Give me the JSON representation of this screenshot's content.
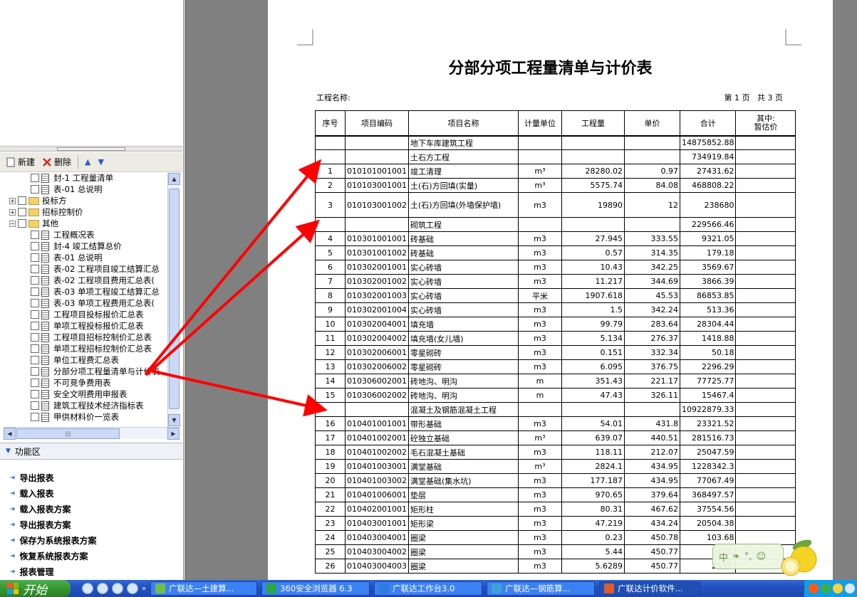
{
  "toolbar": {
    "new": "新建",
    "delete": "删除"
  },
  "tree": [
    {
      "label": "封-1 工程量清单",
      "kind": "doc",
      "lvl": 2
    },
    {
      "label": "表-01 总说明",
      "kind": "doc",
      "lvl": 2
    },
    {
      "label": "投标方",
      "kind": "folder",
      "lvl": 0
    },
    {
      "label": "招标控制价",
      "kind": "folder",
      "lvl": 0
    },
    {
      "label": "其他",
      "kind": "folder-open",
      "lvl": 0
    },
    {
      "label": "工程概况表",
      "kind": "doc",
      "lvl": 2
    },
    {
      "label": "封-4 竣工结算总价",
      "kind": "doc",
      "lvl": 2
    },
    {
      "label": "表-01 总说明",
      "kind": "doc",
      "lvl": 2
    },
    {
      "label": "表-02 工程项目竣工结算汇总",
      "kind": "doc",
      "lvl": 2
    },
    {
      "label": "表-02 工程项目费用汇总表(",
      "kind": "doc",
      "lvl": 2
    },
    {
      "label": "表-03 单项工程竣工结算汇总",
      "kind": "doc",
      "lvl": 2
    },
    {
      "label": "表-03 单项工程费用汇总表(",
      "kind": "doc",
      "lvl": 2
    },
    {
      "label": "工程项目投标报价汇总表",
      "kind": "doc",
      "lvl": 2
    },
    {
      "label": "单项工程投标报价汇总表",
      "kind": "doc",
      "lvl": 2
    },
    {
      "label": "工程项目招标控制价汇总表",
      "kind": "doc",
      "lvl": 2
    },
    {
      "label": "单项工程招标控制价汇总表",
      "kind": "doc",
      "lvl": 2
    },
    {
      "label": "单位工程费汇总表",
      "kind": "doc",
      "lvl": 2
    },
    {
      "label": "分部分项工程量清单与计价表",
      "kind": "doc",
      "lvl": 2
    },
    {
      "label": "不可竞争费用表",
      "kind": "doc",
      "lvl": 2
    },
    {
      "label": "安全文明费用申报表",
      "kind": "doc",
      "lvl": 2
    },
    {
      "label": "建筑工程技术经济指标表",
      "kind": "doc",
      "lvl": 2
    },
    {
      "label": "甲供材料价一览表",
      "kind": "doc",
      "lvl": 2
    }
  ],
  "func_header": "功能区",
  "funcs": [
    "导出报表",
    "载入报表",
    "载入报表方案",
    "导出报表方案",
    "保存为系统报表方案",
    "恢复系统报表方案",
    "报表管理"
  ],
  "report": {
    "title": "分部分项工程量清单与计价表",
    "project_label": "工程名称:",
    "page_info": "第 1 页   共 3 页",
    "headers": [
      "序号",
      "项目编码",
      "项目名称",
      "计量单位",
      "工程量",
      "单价",
      "合计",
      "其中:\n暂估价"
    ],
    "rows": [
      [
        "",
        "",
        "地下车库建筑工程",
        "",
        "",
        "",
        "14875852.88",
        ""
      ],
      [
        "",
        "",
        "土石方工程",
        "",
        "",
        "",
        "734919.84",
        ""
      ],
      [
        "1",
        "010101001001",
        "竣工清理",
        "m³",
        "28280.02",
        "0.97",
        "27431.62",
        ""
      ],
      [
        "2",
        "010103001001",
        "土(石)方回填(实量)",
        "m³",
        "5575.74",
        "84.08",
        "468808.22",
        ""
      ],
      [
        "3",
        "010103001002",
        "土(石)方回填(外墙保护墙)",
        "m3",
        "19890",
        "12",
        "238680",
        ""
      ],
      [
        "",
        "",
        "砌筑工程",
        "",
        "",
        "",
        "229566.46",
        ""
      ],
      [
        "4",
        "010301001001",
        "砖基础",
        "m3",
        "27.945",
        "333.55",
        "9321.05",
        ""
      ],
      [
        "5",
        "010301001002",
        "砖基础",
        "m3",
        "0.57",
        "314.35",
        "179.18",
        ""
      ],
      [
        "6",
        "010302001001",
        "实心砖墙",
        "m3",
        "10.43",
        "342.25",
        "3569.67",
        ""
      ],
      [
        "7",
        "010302001002",
        "实心砖墙",
        "m3",
        "11.217",
        "344.69",
        "3866.39",
        ""
      ],
      [
        "8",
        "010302001003",
        "实心砖墙",
        "平米",
        "1907.618",
        "45.53",
        "86853.85",
        ""
      ],
      [
        "9",
        "010302001004",
        "实心砖墙",
        "m3",
        "1.5",
        "342.24",
        "513.36",
        ""
      ],
      [
        "10",
        "010302004001",
        "填充墙",
        "m3",
        "99.79",
        "283.64",
        "28304.44",
        ""
      ],
      [
        "11",
        "010302004002",
        "填充墙(女儿墙)",
        "m3",
        "5.134",
        "276.37",
        "1418.88",
        ""
      ],
      [
        "12",
        "010302006001",
        "零星砌砖",
        "m3",
        "0.151",
        "332.34",
        "50.18",
        ""
      ],
      [
        "13",
        "010302006002",
        "零星砌砖",
        "m3",
        "6.095",
        "376.75",
        "2296.29",
        ""
      ],
      [
        "14",
        "010306002001",
        "砖地沟、明沟",
        "m",
        "351.43",
        "221.17",
        "77725.77",
        ""
      ],
      [
        "15",
        "010306002002",
        "砖地沟、明沟",
        "m",
        "47.43",
        "326.11",
        "15467.4",
        ""
      ],
      [
        "",
        "",
        "混凝土及钢筋混凝土工程",
        "",
        "",
        "",
        "10922879.33",
        ""
      ],
      [
        "16",
        "010401001001",
        "带形基础",
        "m3",
        "54.01",
        "431.8",
        "23321.52",
        ""
      ],
      [
        "17",
        "010401002001",
        "砼独立基础",
        "m³",
        "639.07",
        "440.51",
        "281516.73",
        ""
      ],
      [
        "18",
        "010401002002",
        "毛石混凝土基础",
        "m3",
        "118.11",
        "212.07",
        "25047.59",
        ""
      ],
      [
        "19",
        "010401003001",
        "满堂基础",
        "m³",
        "2824.1",
        "434.95",
        "1228342.3",
        ""
      ],
      [
        "20",
        "010401003002",
        "满堂基础(集水坑)",
        "m3",
        "177.187",
        "434.95",
        "77067.49",
        ""
      ],
      [
        "21",
        "010401006001",
        "垫层",
        "m3",
        "970.65",
        "379.64",
        "368497.57",
        ""
      ],
      [
        "22",
        "010402001001",
        "矩形柱",
        "m3",
        "80.31",
        "467.62",
        "37554.56",
        ""
      ],
      [
        "23",
        "010403001001",
        "矩形梁",
        "m3",
        "47.219",
        "434.24",
        "20504.38",
        ""
      ],
      [
        "24",
        "010403004001",
        "圈梁",
        "m3",
        "0.23",
        "450.78",
        "103.68",
        ""
      ],
      [
        "25",
        "010403004002",
        "圈梁",
        "m3",
        "5.44",
        "450.77",
        "2452.",
        ""
      ],
      [
        "26",
        "010403004003",
        "圈梁",
        "m3",
        "5.6289",
        "450.77",
        "2537.",
        ""
      ]
    ]
  },
  "taskbar": {
    "start": "开始",
    "tasks": [
      "广联达—土建算...",
      "360安全浏览器 6.3",
      "广联达工作台3.0",
      "广联达—钢筋算...",
      "广联达计价软件..."
    ]
  },
  "ime": {
    "char": "中"
  },
  "colors": {
    "arrow": "#ff0000",
    "taskbar": "#245edb",
    "start": "#3c9a34"
  }
}
